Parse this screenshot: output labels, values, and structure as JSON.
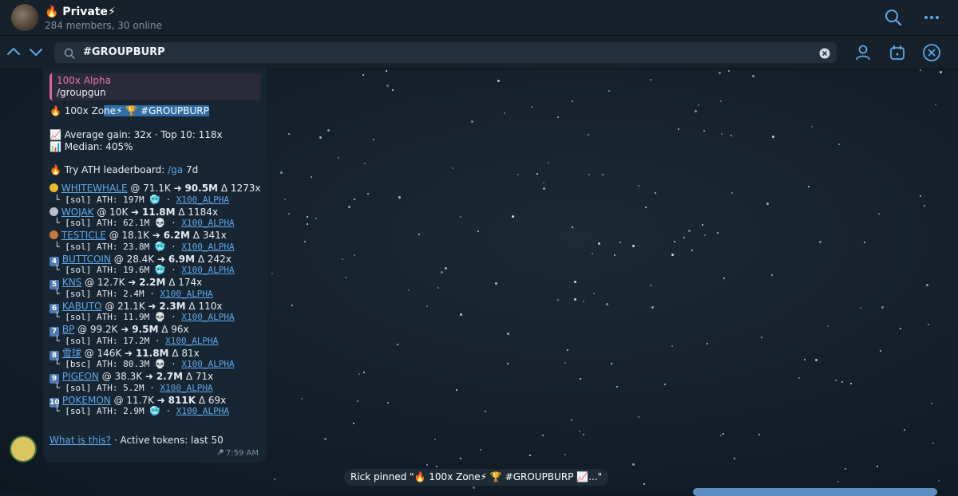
{
  "header": {
    "title": "🔥 Private⚡",
    "subtitle": "284 members, 30 online"
  },
  "search": {
    "query": "#GROUPBURP"
  },
  "message": {
    "reply_name": "100x Alpha",
    "reply_text": "/groupgun",
    "title_prefix": "🔥 100x Zo",
    "title_hl": "ne⚡ 🏆 ",
    "title_tag": "#GROUPBURP",
    "stats_line1": "📈 Average gain: 32x · Top 10: 118x",
    "stats_line2": "📊 Median: 405%",
    "try_prefix": "🔥 Try ATH leaderboard: ",
    "try_cmd": "/ga",
    "try_suffix": " 7d",
    "entries": [
      {
        "rank": "🥇",
        "name": "WHITEWHALE",
        "from": "71.1K",
        "to": "90.5M",
        "mult": "1273x",
        "chain": "[sol]",
        "ath": "197M",
        "emoji": "🥶",
        "ref": "X100_ALPHA"
      },
      {
        "rank": "🥈",
        "name": "WOJAK",
        "from": "10K",
        "to": "11.8M",
        "mult": "1184x",
        "chain": "[sol]",
        "ath": "62.1M",
        "emoji": "💀",
        "ref": "X100_ALPHA"
      },
      {
        "rank": "🥉",
        "name": "TESTICLE",
        "from": "18.1K",
        "to": "6.2M",
        "mult": "341x",
        "chain": "[sol]",
        "ath": "23.8M",
        "emoji": "🥶",
        "ref": "X100_ALPHA"
      },
      {
        "rank": "4",
        "name": "BUTTCOIN",
        "from": "28.4K",
        "to": "6.9M",
        "mult": "242x",
        "chain": "[sol]",
        "ath": "19.6M",
        "emoji": "🥶",
        "ref": "X100_ALPHA"
      },
      {
        "rank": "5",
        "name": "KNS",
        "from": "12.7K",
        "to": "2.2M",
        "mult": "174x",
        "chain": "[sol]",
        "ath": "2.4M",
        "emoji": "",
        "ref": "X100_ALPHA"
      },
      {
        "rank": "6",
        "name": "KABUTO",
        "from": "21.1K",
        "to": "2.3M",
        "mult": "110x",
        "chain": "[sol]",
        "ath": "11.9M",
        "emoji": "💀",
        "ref": "X100_ALPHA"
      },
      {
        "rank": "7",
        "name": "BP",
        "from": "99.2K",
        "to": "9.5M",
        "mult": "96x",
        "chain": "[sol]",
        "ath": "17.2M",
        "emoji": "",
        "ref": "X100_ALPHA"
      },
      {
        "rank": "8",
        "name": "雪球",
        "from": "146K",
        "to": "11.8M",
        "mult": "81x",
        "chain": "[bsc]",
        "ath": "80.3M",
        "emoji": "💀",
        "ref": "X100_ALPHA"
      },
      {
        "rank": "9",
        "name": "PIGEON",
        "from": "38.3K",
        "to": "2.7M",
        "mult": "71x",
        "chain": "[sol]",
        "ath": "5.2M",
        "emoji": "",
        "ref": "X100_ALPHA"
      },
      {
        "rank": "10",
        "name": "POKEMON",
        "from": "11.7K",
        "to": "811K",
        "mult": "69x",
        "chain": "[sol]",
        "ath": "2.9M",
        "emoji": "🥶",
        "ref": "X100_ALPHA"
      }
    ],
    "footer_link": "What is this?",
    "footer_text": " · Active tokens: last 50",
    "time": "7:59 AM"
  },
  "service": {
    "text": "Rick pinned \"🔥 100x Zone⚡ 🏆 #GROUPBURP  📈...\""
  },
  "colors": {
    "accent": "#5ea8e8",
    "header_bg": "#17212b",
    "bubble_bg": "#182533",
    "highlight": "#2f6ea5"
  },
  "icons": {
    "search": "search-icon",
    "more": "more-icon",
    "up": "chevron-up-icon",
    "down": "chevron-down-icon",
    "clear": "clear-icon",
    "user": "user-icon",
    "calendar": "calendar-icon",
    "close": "close-icon",
    "pin": "pin-icon"
  }
}
